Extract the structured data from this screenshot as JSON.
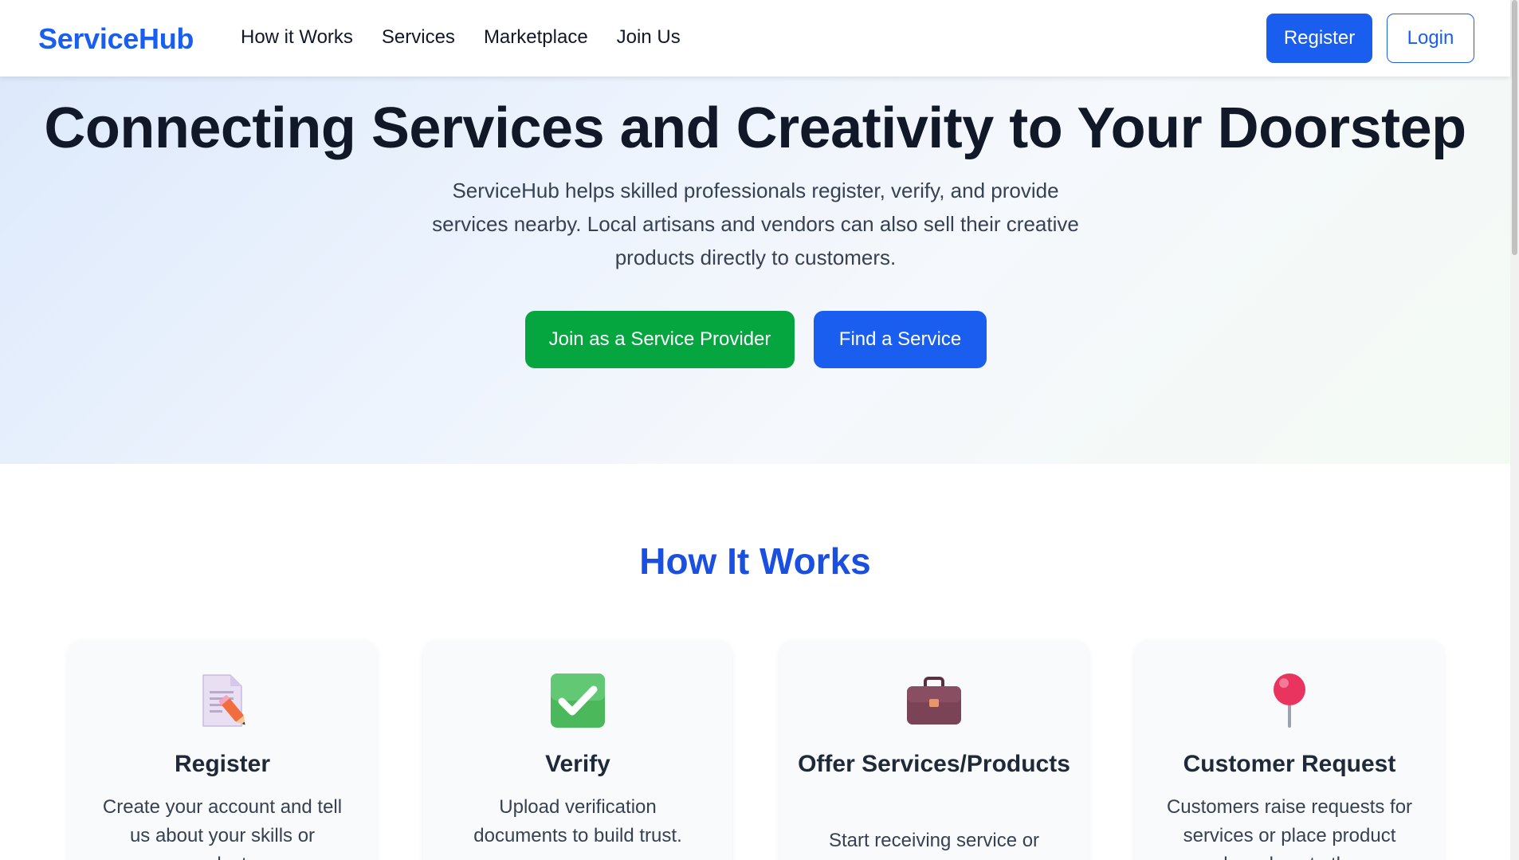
{
  "nav": {
    "brand": "ServiceHub",
    "links": [
      "How it Works",
      "Services",
      "Marketplace",
      "Join Us"
    ],
    "register_label": "Register",
    "login_label": "Login"
  },
  "hero": {
    "title": "Connecting Services and Creativity to Your Doorstep",
    "subtitle": "ServiceHub helps skilled professionals register, verify, and provide services nearby. Local artisans and vendors can also sell their creative products directly to customers.",
    "primary_cta": "Join as a Service Provider",
    "secondary_cta": "Find a Service"
  },
  "how_it_works": {
    "title": "How It Works",
    "cards": [
      {
        "icon": "memo-pencil-icon",
        "title": "Register",
        "desc": "Create your account and tell us about your skills or products."
      },
      {
        "icon": "check-mark-icon",
        "title": "Verify",
        "desc": "Upload verification documents to build trust."
      },
      {
        "icon": "briefcase-icon",
        "title": "Offer Services/Products",
        "desc": "Start receiving service or product orders nearby."
      },
      {
        "icon": "pushpin-icon",
        "title": "Customer Request",
        "desc": "Customers raise requests for services or place product orders close to them."
      }
    ]
  },
  "colors": {
    "brand_blue": "#1a5ef0",
    "cta_green": "#05a63f",
    "heading_blue": "#1a4fe0"
  }
}
